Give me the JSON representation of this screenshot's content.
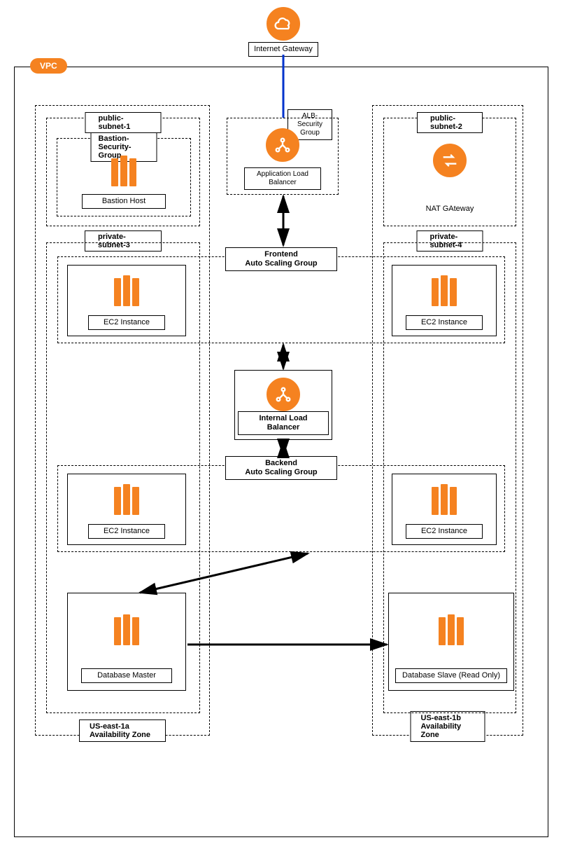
{
  "internet_gateway": "Internet Gateway",
  "vpc_tag": "VPC",
  "alb_sg": "ALB-\nSecurity\nGroup",
  "alb": "Application Load\nBalancer",
  "nat": "NAT GAteway",
  "frontend_asg": "Frontend\nAuto Scaling Group",
  "ilb": "Internal Load Balancer",
  "backend_asg": "Backend\nAuto Scaling Group",
  "az_left": {
    "name": "US-east-1a Availability Zone",
    "public_subnet": "public-subnet-1",
    "private_subnet": "private-subnet-3",
    "bastion_sg": "Bastion-Security-Group",
    "bastion": "Bastion Host",
    "ec2_frontend": "EC2 Instance",
    "ec2_backend": "EC2 Instance",
    "db": "Database Master"
  },
  "az_right": {
    "name": "US-east-1b Availability Zone",
    "public_subnet": "public-subnet-2",
    "private_subnet": "private-subnet-4",
    "ec2_frontend": "EC2 Instance",
    "ec2_backend": "EC2 Instance",
    "db": "Database Slave (Read Only)"
  }
}
